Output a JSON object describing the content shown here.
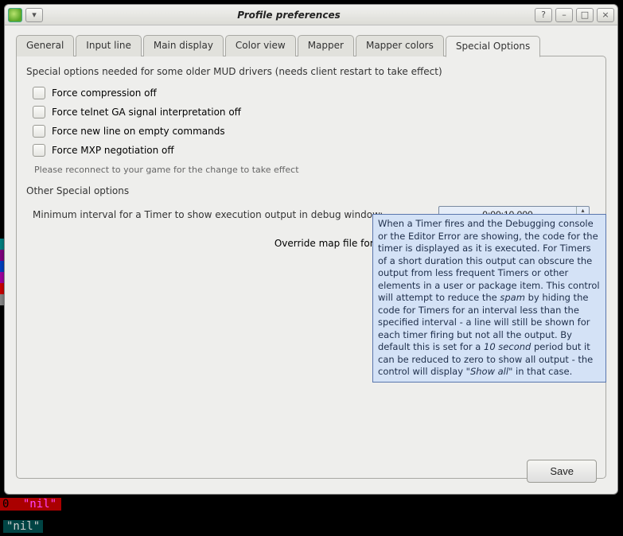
{
  "title": "Profile preferences",
  "titlebar_buttons": {
    "help": "?",
    "min": "–",
    "max": "□",
    "close": "×"
  },
  "tabs": [
    "General",
    "Input line",
    "Main display",
    "Color view",
    "Mapper",
    "Mapper colors",
    "Special Options"
  ],
  "active_tab": "Special Options",
  "section1": {
    "heading": "Special options needed for some older MUD drivers (needs client restart to take effect)",
    "checks": [
      "Force compression off",
      "Force telnet GA signal interpretation off",
      "Force new line on empty commands",
      "Force MXP negotiation off"
    ],
    "note": "Please reconnect to your game for the change to take effect"
  },
  "section2": {
    "heading": "Other Special options",
    "timer_label": "Minimum interval for a Timer to show execution output in debug window:",
    "timer_value": "0:00:10.000",
    "override_label": "Override map file format version:",
    "override_value": ""
  },
  "tooltip_html": "When a Timer fires and the Debugging console or the Editor Error are showing, the code for the timer is displayed as it is executed. For Timers of a short duration this output can obscure the output from less frequent Timers or other elements in a user or package item. This control will attempt to reduce the <i>spam</i> by hiding the code for Timers for an interval less than the specified interval - a line will still be shown for each timer firing but not all the output.  By default this is set for a <i>10 second</i> period but it can be reduced to zero to show all output - the control will display \"<i>Show all</i>\" in that case.",
  "save_label": "Save",
  "terminal": {
    "line1_a": "0",
    "line1_b": " \"nil\"",
    "line2": "\"nil\""
  }
}
